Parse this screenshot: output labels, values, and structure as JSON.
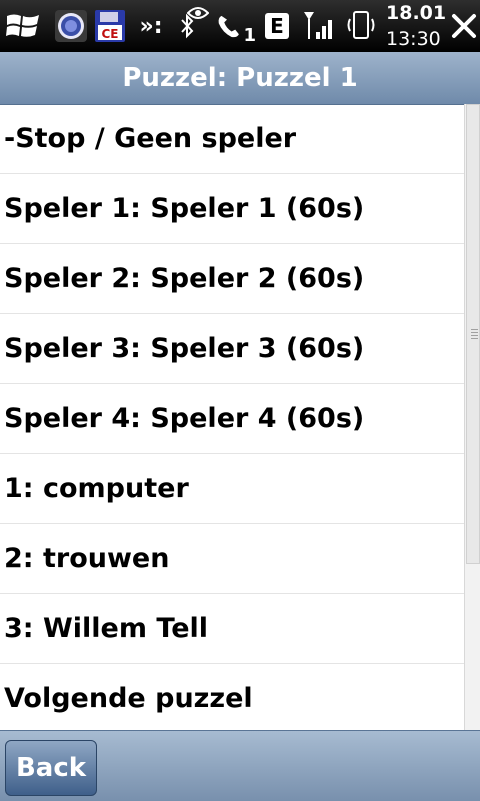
{
  "statusbar": {
    "date": "18.01",
    "time": "13:30",
    "overflow": "»:",
    "edge": "E",
    "call_count": "1",
    "app2_label": "CE",
    "icons": [
      "windows-logo",
      "app-circle-icon",
      "app-ce-icon",
      "bluetooth-icon",
      "eye-icon",
      "phone-icon",
      "edge-network-icon",
      "signal-icon",
      "device-icon",
      "close-icon"
    ]
  },
  "title": "Puzzel: Puzzel 1",
  "items": [
    {
      "label": "-Stop / Geen speler"
    },
    {
      "label": "Speler 1: Speler 1 (60s)"
    },
    {
      "label": "Speler 2: Speler 2 (60s)"
    },
    {
      "label": "Speler 3: Speler 3 (60s)"
    },
    {
      "label": "Speler 4: Speler 4 (60s)"
    },
    {
      "label": "1: computer"
    },
    {
      "label": "2: trouwen"
    },
    {
      "label": "3: Willem Tell"
    },
    {
      "label": "Volgende puzzel"
    }
  ],
  "softkeys": {
    "back": "Back"
  },
  "colors": {
    "title_bar": "#8aa1bd",
    "bottom_bar": "#8fa3bc",
    "button": "#5a79a0"
  }
}
